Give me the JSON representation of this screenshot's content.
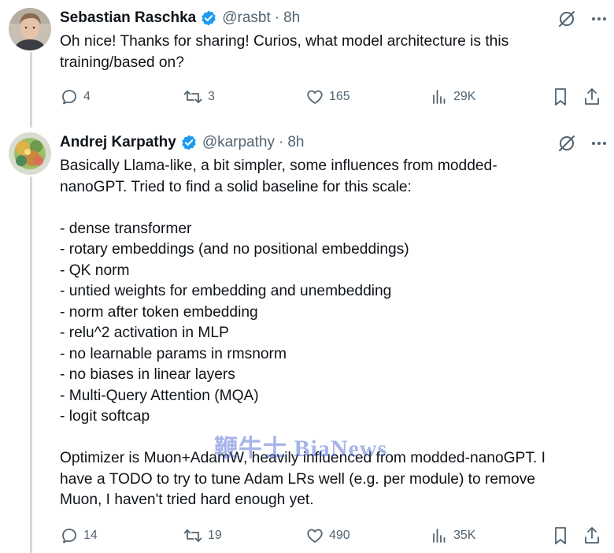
{
  "tweets": [
    {
      "name": "Sebastian Raschka",
      "handle": "@rasbt",
      "dot": "·",
      "time": "8h",
      "text": "Oh nice! Thanks for sharing! Curios, what model architecture is this\ntraining/based on?",
      "replies": "4",
      "reposts": "3",
      "likes": "165",
      "views": "29K"
    },
    {
      "name": "Andrej Karpathy",
      "handle": "@karpathy",
      "dot": "·",
      "time": "8h",
      "text": "Basically Llama-like, a bit simpler, some influences from modded-\nnanoGPT. Tried to find a solid baseline for this scale:\n\n- dense transformer\n- rotary embeddings (and no positional embeddings)\n- QK norm\n- untied weights for embedding and unembedding\n- norm after token embedding\n- relu^2 activation in MLP\n- no learnable params in rmsnorm\n- no biases in linear layers\n- Multi-Query Attention (MQA)\n- logit softcap\n\nOptimizer is Muon+AdamW, heavily influenced from modded-nanoGPT. I\nhave a TODO to try to tune Adam LRs well (e.g. per module) to remove\nMuon, I haven't tried hard enough yet.",
      "replies": "14",
      "reposts": "19",
      "likes": "490",
      "views": "35K"
    }
  ],
  "watermark": "鞭牛士 BiaNews",
  "colors": {
    "text": "#0f1419",
    "secondary": "#536471",
    "verified": "#1d9bf0",
    "thread_line": "#cfd9de"
  },
  "icons": [
    "verified-badge-icon",
    "grok-icon",
    "more-icon",
    "reply-icon",
    "repost-icon",
    "like-icon",
    "views-icon",
    "bookmark-icon",
    "share-icon"
  ]
}
